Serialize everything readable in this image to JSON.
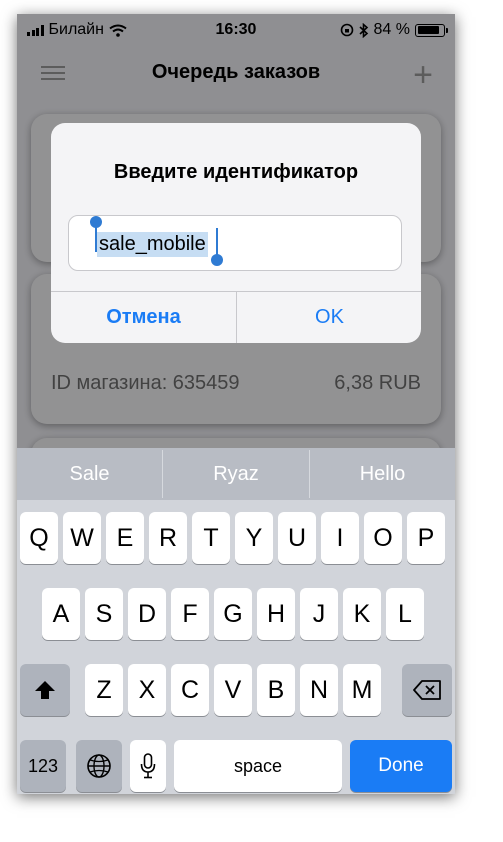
{
  "status_bar": {
    "carrier": "Билайн",
    "time": "16:30",
    "battery": "84 %"
  },
  "navbar": {
    "title": "Очередь заказов"
  },
  "order_card": {
    "shop_id": "ID магазина: 635459",
    "amount": "6,38 RUB"
  },
  "alert": {
    "title": "Введите идентификатор",
    "input_value": "sale_mobile",
    "cancel_label": "Отмена",
    "ok_label": "OK"
  },
  "keyboard": {
    "suggestions": [
      "Sale",
      "Ryaz",
      "Hello"
    ],
    "row1": [
      "Q",
      "W",
      "E",
      "R",
      "T",
      "Y",
      "U",
      "I",
      "O",
      "P"
    ],
    "row2": [
      "A",
      "S",
      "D",
      "F",
      "G",
      "H",
      "J",
      "K",
      "L"
    ],
    "row3": [
      "Z",
      "X",
      "C",
      "V",
      "B",
      "N",
      "M"
    ],
    "numbers_label": "123",
    "space_label": "space",
    "done_label": "Done"
  },
  "colors": {
    "accent": "#1a7cf5",
    "selection": "#c6ddf3"
  }
}
